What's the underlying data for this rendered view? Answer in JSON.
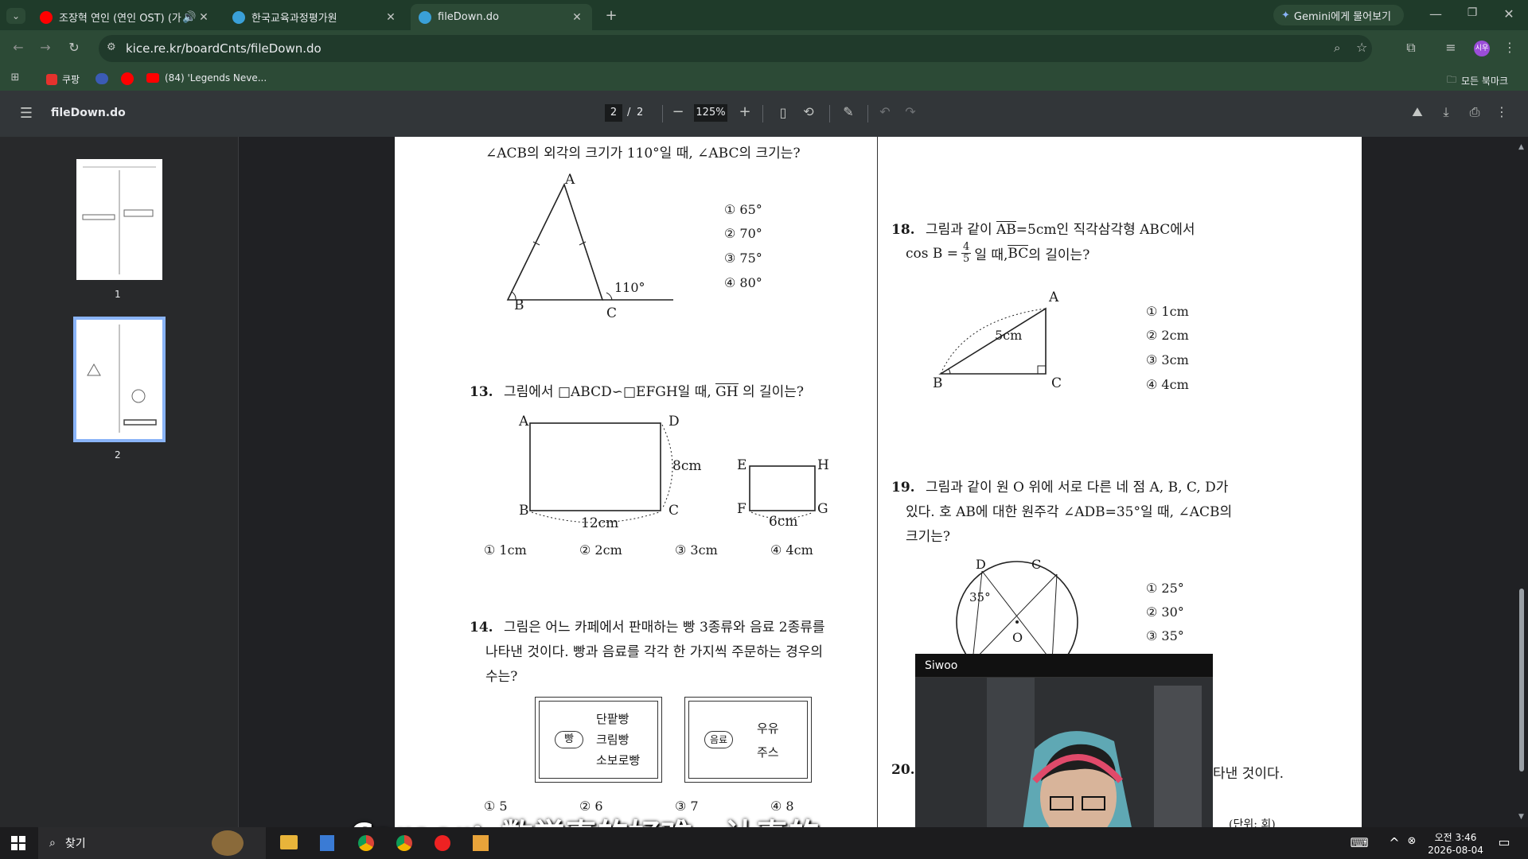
{
  "tabs": [
    {
      "title": "조장혁 연인 (연인 OST) (가",
      "favicon_color": "#ff0000"
    },
    {
      "title": "한국교육과정평가원",
      "favicon_color": "#3aa0d8"
    },
    {
      "title": "fileDown.do",
      "favicon_color": "#3aa0d8"
    }
  ],
  "gemini_label": "Gemini에게 물어보기",
  "url": "kice.re.kr/boardCnts/fileDown.do",
  "bookmarks": {
    "coupang": "쿠팡",
    "youtube": "(84) 'Legends Neve...",
    "all": "모든 북마크"
  },
  "pdf": {
    "filename": "fileDown.do",
    "page_current": "2",
    "page_sep": "/",
    "page_total": "2",
    "zoom": "125%",
    "thumbs": [
      "1",
      "2"
    ]
  },
  "q12": {
    "stem": "∠ACB의 외각의 크기가 110°일 때, ∠ABC의 크기는?",
    "labels": {
      "A": "A",
      "B": "B",
      "C": "C",
      "angle": "110°"
    },
    "options": [
      "① 65°",
      "② 70°",
      "③ 75°",
      "④ 80°"
    ]
  },
  "q13": {
    "num": "13.",
    "stem": "그림에서 □ABCD∽□EFGH일 때, ",
    "gh": "GH",
    "stem_end": "의 길이는?",
    "labels": {
      "A": "A",
      "B": "B",
      "C": "C",
      "D": "D",
      "E": "E",
      "F": "F",
      "G": "G",
      "H": "H",
      "side1": "8cm",
      "side2": "12cm",
      "side3": "6cm"
    },
    "options": [
      "① 1cm",
      "② 2cm",
      "③ 3cm",
      "④ 4cm"
    ]
  },
  "q14": {
    "num": "14.",
    "line1": "그림은 어느 카페에서 판매하는 빵 3종류와 음료 2종류를",
    "line2": "나타낸 것이다. 빵과 음료를 각각 한 가지씩 주문하는 경우의",
    "line3": "수는?",
    "bread_tag": "빵",
    "breads": [
      "단팥빵",
      "크림빵",
      "소보로빵"
    ],
    "drink_tag": "음료",
    "drinks": [
      "우유",
      "주스"
    ],
    "options": [
      "① 5",
      "② 6",
      "③ 7",
      "④ 8"
    ]
  },
  "q18": {
    "num": "18.",
    "line1a": "그림과 같이 ",
    "ab": "AB",
    "line1b": "=5cm인 직각삼각형 ABC에서",
    "line2a": "cos B = ",
    "frac_num": "4",
    "frac_den": "5",
    "line2b": "일 때, ",
    "bc": "BC",
    "line2c": "의 길이는?",
    "labels": {
      "A": "A",
      "B": "B",
      "C": "C",
      "side": "5cm"
    },
    "options": [
      "① 1cm",
      "② 2cm",
      "③ 3cm",
      "④ 4cm"
    ]
  },
  "q19": {
    "num": "19.",
    "line1": "그림과 같이 원 O 위에 서로 다른 네 점 A, B, C, D가",
    "line2": "있다. 호 AB에 대한 원주각 ∠ADB=35°일 때, ∠ACB의",
    "line3": "크기는?",
    "labels": {
      "D": "D",
      "C": "C",
      "O": "O",
      "angle": "35°"
    },
    "options": [
      "① 25°",
      "② 30°",
      "③ 35°"
    ]
  },
  "q20": {
    "num": "20.",
    "tail": "타낸 것이다.",
    "unit": "(단위: 회)"
  },
  "webcam_name": "Siwoo",
  "subtitle": "Career：数学真的好难，认真的",
  "taskbar": {
    "search": "찾기",
    "time": "오전 3:46",
    "date": "2026-08-04"
  }
}
